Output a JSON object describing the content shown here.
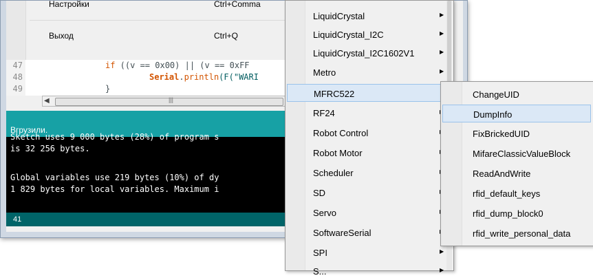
{
  "file_menu": {
    "items": [
      {
        "label": "Настройки",
        "shortcut": "Ctrl+Comma"
      },
      {
        "label": "Выход",
        "shortcut": "Ctrl+Q"
      }
    ]
  },
  "editor": {
    "line_numbers": [
      "47",
      "48",
      "49"
    ],
    "line47": {
      "kw": "if",
      "rest": " ((v == 0x00) || (v == 0xFF"
    },
    "line48": {
      "fn": "Serial",
      "rest1": ".",
      "fn2": "println",
      "rest2": "(F(\"WARI"
    },
    "line49": "}"
  },
  "status": {
    "message": "Вгрузили."
  },
  "console": {
    "lines": [
      "Sketch uses 9 000 bytes (28%) of program s",
      "is 32 256 bytes.",
      "",
      "Global variables use 219 bytes (10%) of dy",
      "1 829 bytes for local variables. Maximum i"
    ]
  },
  "linebar": {
    "line": "41"
  },
  "libraries_menu": {
    "items": [
      {
        "label": "LiquidCrystal",
        "submenu": true
      },
      {
        "label": "LiquidCrystal_I2C",
        "submenu": true
      },
      {
        "label": "LiquidCrystal_I2C1602V1",
        "submenu": true
      },
      {
        "label": "Metro",
        "submenu": true
      },
      {
        "label": "MFRC522",
        "submenu": true,
        "highlighted": true
      },
      {
        "label": "RF24",
        "submenu": true
      },
      {
        "label": "Robot Control",
        "submenu": true
      },
      {
        "label": "Robot Motor",
        "submenu": true
      },
      {
        "label": "Scheduler",
        "submenu": true
      },
      {
        "label": "SD",
        "submenu": true
      },
      {
        "label": "Servo",
        "submenu": true
      },
      {
        "label": "SoftwareSerial",
        "submenu": true
      },
      {
        "label": "SPI",
        "submenu": true
      },
      {
        "label": "S...",
        "submenu": true
      }
    ]
  },
  "mfrc522_examples": {
    "items": [
      {
        "label": "ChangeUID"
      },
      {
        "label": "DumpInfo",
        "highlighted": true
      },
      {
        "label": "FixBrickedUID"
      },
      {
        "label": "MifareClassicValueBlock"
      },
      {
        "label": "ReadAndWrite"
      },
      {
        "label": "rfid_default_keys"
      },
      {
        "label": "rfid_dump_block0"
      },
      {
        "label": "rfid_write_personal_data"
      }
    ]
  },
  "icons": {
    "submenu_arrow": "▶",
    "scroll_left": "◀",
    "scroll_grip": "|||"
  },
  "colors": {
    "accent": "#17a1a5",
    "linebar": "#006468",
    "highlight": "#dbe8f6"
  }
}
